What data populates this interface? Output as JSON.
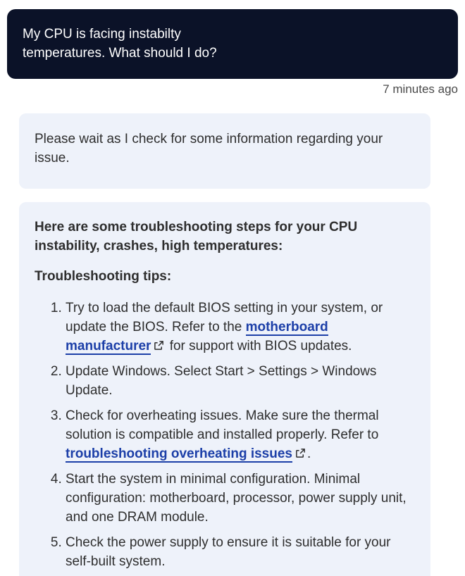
{
  "user_message": {
    "line1": "My CPU is facing instabilty",
    "line2": "temperatures. What should I do?",
    "timestamp": "7 minutes ago"
  },
  "bot_wait_message": {
    "text": "Please wait as I check for some information regarding your issue."
  },
  "bot_steps_message": {
    "heading": "Here are some troubleshooting steps for your CPU instability, crashes, high temperatures:",
    "tips_heading": "Troubleshooting tips:",
    "steps": [
      {
        "before": "Try to load the default BIOS setting in your system, or update the BIOS. Refer to the ",
        "link": "motherboard manufacturer",
        "after": " for support with BIOS updates."
      },
      {
        "text": "Update Windows. Select Start > Settings > Windows Update."
      },
      {
        "before": "Check for overheating issues. Make sure the thermal solution is compatible and installed properly. Refer to ",
        "link": "troubleshooting overheating issues",
        "after": "."
      },
      {
        "text": "Start the system in minimal configuration. Minimal configuration: motherboard, processor, power supply unit, and one DRAM module."
      },
      {
        "text": "Check the power supply to ensure it is suitable for your self-built system."
      }
    ]
  },
  "icons": {
    "external_link": "external-link-icon"
  },
  "colors": {
    "user_bubble_bg": "#0b1228",
    "bot_bubble_bg": "#eef2fa",
    "link": "#1c3fa8"
  }
}
